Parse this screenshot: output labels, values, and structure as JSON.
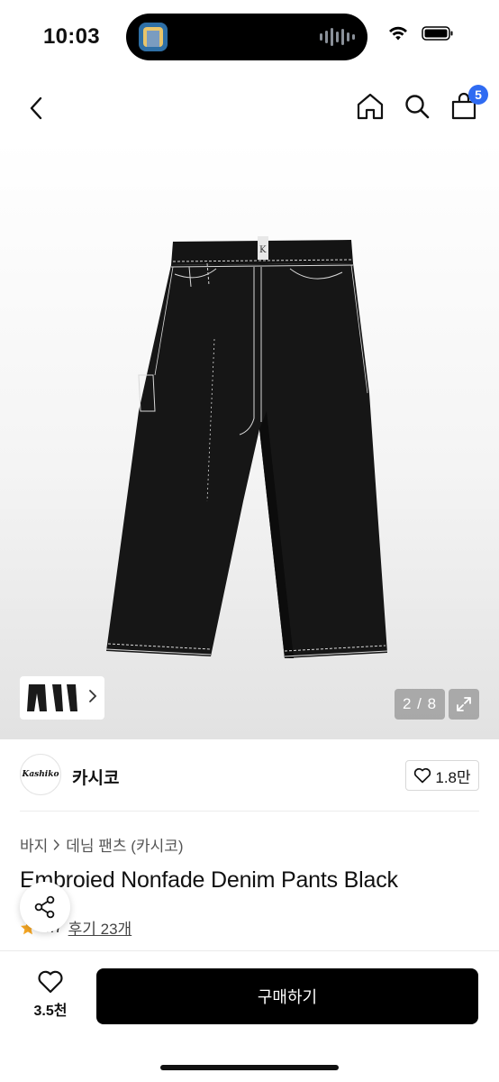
{
  "status_bar": {
    "time": "10:03"
  },
  "icons": {
    "back": "chevron-left-icon",
    "home": "home-icon",
    "search": "search-icon",
    "cart": "shopping-bag-icon",
    "share": "share-icon",
    "wishlist": "heart-icon",
    "expand": "expand-icon"
  },
  "header": {
    "cart_badge": "5"
  },
  "gallery": {
    "page_indicator": "2 / 8"
  },
  "brand": {
    "logo_text": "Kashiko",
    "name": "카시코",
    "like_count": "1.8만"
  },
  "breadcrumb": {
    "category": "바지",
    "subcategory": "데님 팬츠 (카시코)"
  },
  "product": {
    "title": "Embroied Nonfade Denim Pants Black",
    "rating": "4.7",
    "review_link": "후기 23개"
  },
  "bottom_bar": {
    "wish_count": "3.5천",
    "buy_label": "구매하기"
  },
  "colors": {
    "accent_badge": "#2f6bf2",
    "buy_button": "#000000",
    "star": "#f5a623"
  }
}
